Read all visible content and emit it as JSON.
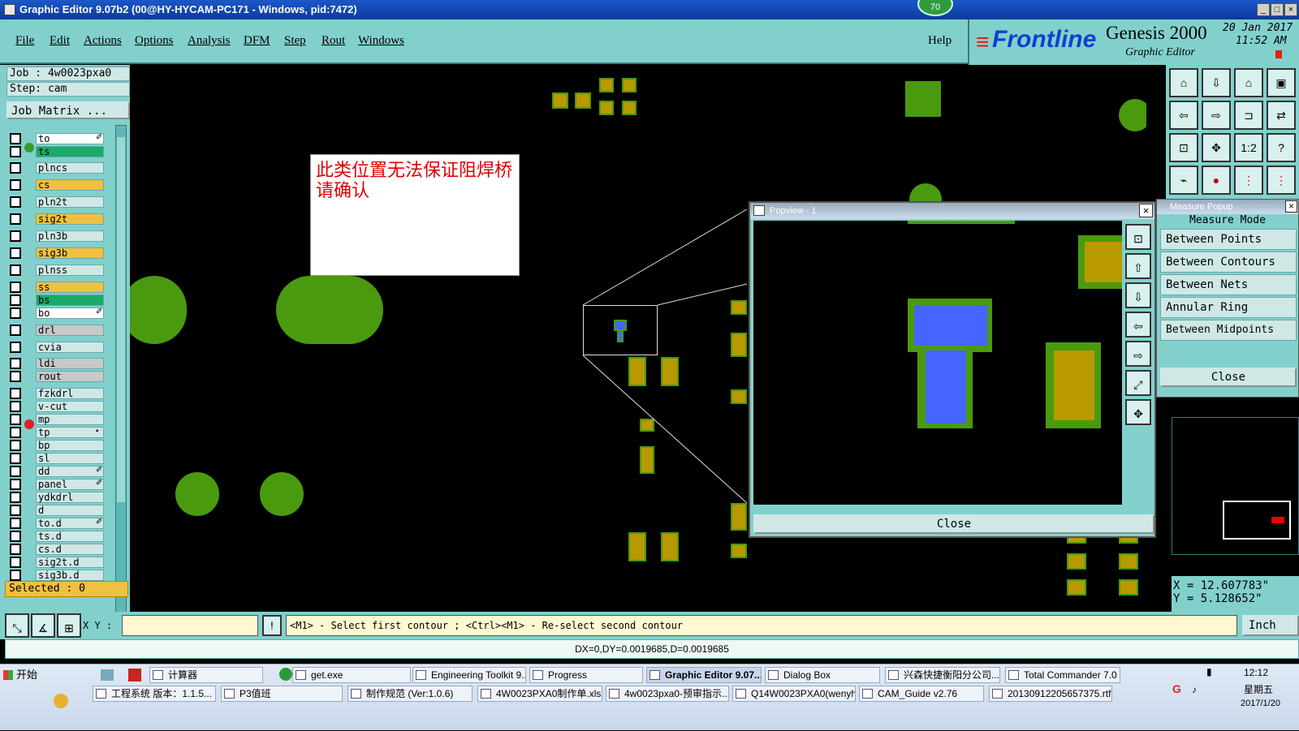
{
  "window": {
    "title": "Graphic Editor 9.07b2 (00@HY-HYCAM-PC171 - Windows, pid:7472)",
    "badge": "70"
  },
  "menu": {
    "items": [
      "File",
      "Edit",
      "Actions",
      "Options",
      "Analysis",
      "DFM",
      "Step",
      "Rout",
      "Windows"
    ],
    "help": "Help"
  },
  "logo": {
    "brand": "Frontline",
    "product": "Genesis 2000",
    "subtitle": "Graphic Editor",
    "date": "20 Jan 2017",
    "time": "11:52 AM"
  },
  "job": {
    "job_label": "Job : 4w0023pxa0",
    "step_label": "Step: cam",
    "matrix_button": "Job Matrix ..."
  },
  "layers": [
    {
      "name": "to",
      "color": "#ffffff",
      "flag": "✐"
    },
    {
      "name": "ts",
      "color": "#1aaa6a",
      "flag": ""
    },
    {
      "name": "plncs",
      "color": "#cfe8e6",
      "flag": ""
    },
    {
      "name": "cs",
      "color": "#f0c040",
      "flag": ""
    },
    {
      "name": "pln2t",
      "color": "#cfe8e6",
      "flag": ""
    },
    {
      "name": "sig2t",
      "color": "#f0c040",
      "flag": ""
    },
    {
      "name": "pln3b",
      "color": "#cfe8e6",
      "flag": ""
    },
    {
      "name": "sig3b",
      "color": "#f0c040",
      "flag": ""
    },
    {
      "name": "plnss",
      "color": "#cfe8e6",
      "flag": ""
    },
    {
      "name": "ss",
      "color": "#f0c040",
      "flag": ""
    },
    {
      "name": "bs",
      "color": "#1aaa6a",
      "flag": ""
    },
    {
      "name": "bo",
      "color": "#ffffff",
      "flag": "✐"
    },
    {
      "name": "drl",
      "color": "#c8c8c8",
      "flag": ""
    },
    {
      "name": "cvia",
      "color": "#cfe8e6",
      "flag": ""
    },
    {
      "name": "ldi",
      "color": "#c8c8c8",
      "flag": ""
    },
    {
      "name": "rout",
      "color": "#c8c8c8",
      "flag": ""
    },
    {
      "name": "fzkdrl",
      "color": "#cfe8e6",
      "flag": ""
    },
    {
      "name": "v-cut",
      "color": "#cfe8e6",
      "flag": ""
    },
    {
      "name": "mp",
      "color": "#cfe8e6",
      "flag": ""
    },
    {
      "name": "tp",
      "color": "#cfe8e6",
      "flag": "▪"
    },
    {
      "name": "bp",
      "color": "#cfe8e6",
      "flag": ""
    },
    {
      "name": "sl",
      "color": "#cfe8e6",
      "flag": ""
    },
    {
      "name": "dd",
      "color": "#cfe8e6",
      "flag": "✐"
    },
    {
      "name": "panel",
      "color": "#cfe8e6",
      "flag": "✐"
    },
    {
      "name": "ydkdrl",
      "color": "#cfe8e6",
      "flag": ""
    },
    {
      "name": "d",
      "color": "#cfe8e6",
      "flag": ""
    },
    {
      "name": "to.d",
      "color": "#cfe8e6",
      "flag": "✐"
    },
    {
      "name": "ts.d",
      "color": "#cfe8e6",
      "flag": ""
    },
    {
      "name": "cs.d",
      "color": "#cfe8e6",
      "flag": ""
    },
    {
      "name": "sig2t.d",
      "color": "#cfe8e6",
      "flag": ""
    },
    {
      "name": "sig3b.d",
      "color": "#cfe8e6",
      "flag": ""
    }
  ],
  "selected": "Selected : 0",
  "note": {
    "text": "此类位置无法保证阻焊桥  请确认"
  },
  "popview": {
    "title": "Popview - 1",
    "close": "Close"
  },
  "measure": {
    "title": "Measure Popup",
    "mode_label": "Measure Mode",
    "modes": [
      "Between Points",
      "Between Contours",
      "Between Nets",
      "Annular Ring",
      "Between Midpoints"
    ],
    "close": "Close"
  },
  "coords": {
    "x": "X = 12.607783\"",
    "y": "Y = 5.128652\""
  },
  "command": {
    "xy_label": "X Y :",
    "input_value": "",
    "prompt": "<M1> - Select first contour ; <Ctrl><M1> - Re-select second contour",
    "units": "Inch"
  },
  "status": {
    "dx": "DX=0,DY=0.0019685,D=0.0019685"
  },
  "taskbar": {
    "start": "开始",
    "row1": [
      "计算器",
      "get.exe",
      "Engineering Toolkit 9....",
      "Progress",
      "Graphic Editor 9.07...",
      "Dialog Box",
      "兴森快捷衡阳分公司...",
      "Total Commander 7.0 ..."
    ],
    "row2": [
      "工程系统  版本：1.1.5...",
      "P3值班",
      "制作规范 (Ver:1.0.6)",
      "4W0023PXA0制作单.xls...",
      "4w0023pxa0-预审指示....",
      "Q14W0023PXA0(wenyh)...",
      "CAM_Guide v2.76",
      "20130912205657375.rtf..."
    ],
    "clock_time": "12:12",
    "clock_day": "星期五",
    "clock_date": "2017/1/20"
  },
  "colors": {
    "teal": "#82d0cc",
    "copper": "#b89a00",
    "mask": "#4a9a10",
    "highlight": "#4466ff"
  }
}
